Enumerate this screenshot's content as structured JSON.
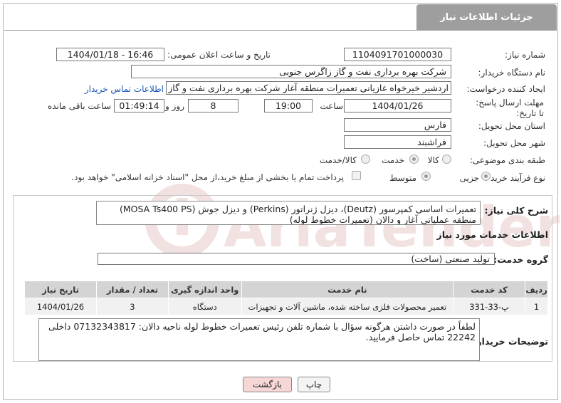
{
  "header": {
    "title": "جزئیات اطلاعات نیاز"
  },
  "fields": {
    "need_number_label": "شماره نیاز:",
    "need_number": "1104091701000030",
    "announce_label": "تاریخ و ساعت اعلان عمومی:",
    "announce_value": "1404/01/18 - 16:46",
    "buyer_org_label": "نام دستگاه خریدار:",
    "buyer_org": "شرکت بهره برداری نفت و گاز زاگرس جنوبی",
    "creator_label": "ایجاد کننده درخواست:",
    "creator": "اردشیر خیرخواه غازیانی تعمیرات منطقه آغار شرکت بهره برداری نفت و گاز زاگرس",
    "contact_link": "اطلاعات تماس خریدار",
    "deadline_label": "مهلت ارسال پاسخ: تا تاریخ:",
    "deadline_date": "1404/01/26",
    "time_label": "ساعت",
    "deadline_time": "19:00",
    "days_value": "8",
    "days_label": "روز و",
    "remaining_time": "01:49:14",
    "remaining_label": "ساعت باقی مانده",
    "province_label": "استان محل تحویل:",
    "province": "فارس",
    "city_label": "شهر محل تحویل:",
    "city": "فراشبند",
    "category_label": "طبقه بندی موضوعی:",
    "category_options": [
      "کالا",
      "خدمت",
      "کالا/خدمت"
    ],
    "category_selected": "خدمت",
    "process_label": "نوع فرآیند خرید :",
    "process_options": [
      "جزیی",
      "متوسط"
    ],
    "process_selected": "جزیی",
    "payment_note": "پرداخت تمام یا بخشی از مبلغ خرید،از محل \"اسناد خزانه اسلامی\" خواهد بود."
  },
  "description": {
    "label": "شرح کلی نیاز:",
    "text": "تعمیرات اساسی کمپرسور (Deutz)، دیزل ژنراتور (Perkins) و دیزل جوش (MOSA Ts400 PS) منطقه عملیاتی آغار و دالان (تعمیرات خطوط لوله)"
  },
  "services": {
    "title": "اطلاعات خدمات مورد نیاز",
    "group_label": "گروه خدمت:",
    "group_value": "تولید صنعتی (ساخت)",
    "columns": [
      "ردیف",
      "کد خدمت",
      "نام خدمت",
      "واحد اندازه گیری",
      "تعداد / مقدار",
      "تاریخ نیاز"
    ],
    "rows": [
      [
        "1",
        "پ-33-331",
        "تعمیر محصولات فلزی ساخته شده، ماشین آلات و تجهیزات",
        "دستگاه",
        "3",
        "1404/01/26"
      ]
    ]
  },
  "buyer_notes": {
    "label": "توضیحات خریدار:",
    "text": "لطفاً در صورت داشتن هرگونه سؤال با شماره تلفن رئیس تعمیرات خطوط لوله ناحیه دالان: 07132343817 داخلی 22242 تماس حاصل فرمایید."
  },
  "buttons": {
    "print": "چاپ",
    "back": "بازگشت"
  },
  "watermark": {
    "text": "AriaTender.neT"
  },
  "colors": {
    "header_bg": "#9e9e9e",
    "link": "#1a56b8",
    "back_btn_bg": "#f7d6d6",
    "watermark": "#e8c9c9"
  }
}
